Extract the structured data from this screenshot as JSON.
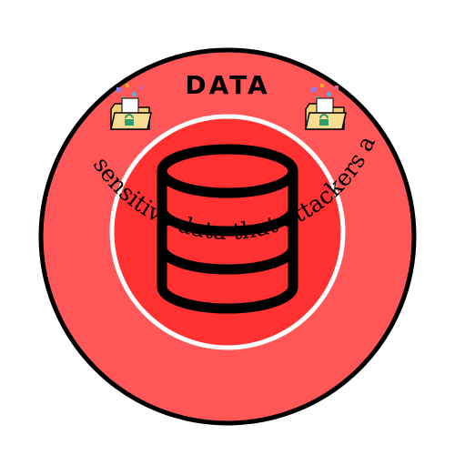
{
  "badge": {
    "title": "DATA",
    "caption": "Represents sensitive data that attackers aim to steal",
    "colors": {
      "ring": "#ff5757",
      "inner_circle": "#ff3131",
      "outline": "#000000",
      "separator": "#ffffff",
      "folder": "#f2d07a",
      "lock": "#2e9e6b"
    },
    "icons": [
      "database-icon",
      "unlocked-folder-icon",
      "unlocked-folder-icon"
    ]
  }
}
